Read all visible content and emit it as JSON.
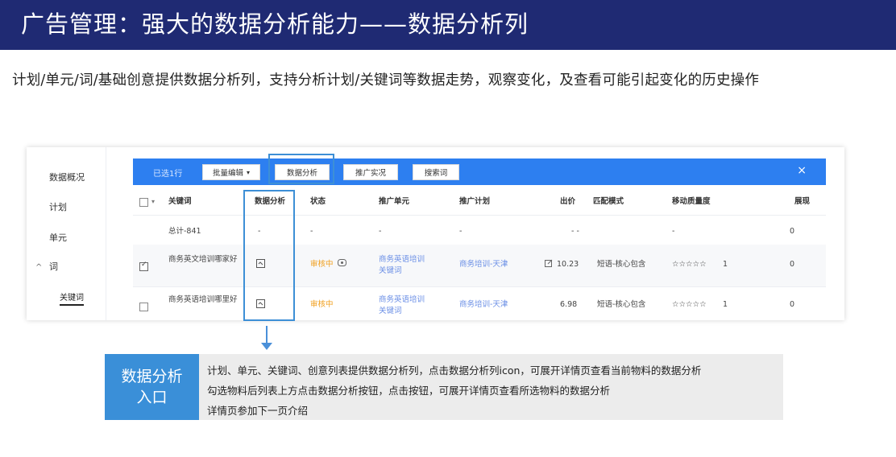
{
  "slide": {
    "title": "广告管理：强大的数据分析能力——数据分析列",
    "description": "计划/单元/词/基础创意提供数据分析列，支持分析计划/关键词等数据走势，观察变化，及查看可能引起变化的历史操作"
  },
  "sidebar": {
    "items": [
      {
        "label": "数据概况"
      },
      {
        "label": "计划"
      },
      {
        "label": "单元"
      },
      {
        "label": "词"
      }
    ],
    "expand_icon": "chevron-up-icon",
    "sub_item": "关键词"
  },
  "toolbar": {
    "selected_label": "已选1行",
    "batch_edit": "批量编辑",
    "data_analysis": "数据分析",
    "promo_report": "推广实况",
    "search_term": "搜索词",
    "close": "×"
  },
  "table": {
    "headers": {
      "keyword": "关键词",
      "analysis": "数据分析",
      "status": "状态",
      "unit": "推广单元",
      "plan": "推广计划",
      "bid": "出价",
      "match": "匹配模式",
      "mobile_quality": "移动质量度",
      "impressions": "展现"
    },
    "total_row": {
      "label": "总计-841",
      "analysis": "-",
      "status": "-",
      "unit": "-",
      "plan": "-",
      "bid": "- -",
      "match": "",
      "mobile_quality": "-",
      "impressions": "0"
    },
    "rows": [
      {
        "keyword": "商务英文培训哪家好",
        "status": "审核中",
        "unit": "商务英语培训关键词",
        "plan": "商务培训-天津",
        "bid": "10.23",
        "match": "短语-核心包含",
        "stars": "☆☆☆☆☆",
        "quality": "1",
        "impressions": "0",
        "checked": true
      },
      {
        "keyword": "商务英语培训哪里好",
        "status": "审核中",
        "unit": "商务英语培训关键词",
        "plan": "商务培训-天津",
        "bid": "6.98",
        "match": "短语-核心包含",
        "stars": "☆☆☆☆☆",
        "quality": "1",
        "impressions": "0",
        "checked": false
      }
    ]
  },
  "callout": {
    "label_line1": "数据分析",
    "label_line2": "入口",
    "lines": [
      "计划、单元、关键词、创意列表提供数据分析列，点击数据分析列icon，可展开详情页查看当前物料的数据分析",
      "勾选物料后列表上方点击数据分析按钮，点击按钮，可展开详情页查看所选物料的数据分析",
      "详情页参加下一页介绍"
    ]
  },
  "colors": {
    "header_bg": "#1f2a73",
    "toolbar_blue": "#2d7ff0",
    "highlight_blue": "#3d8fd6",
    "callout_label_bg": "#3a8fd8",
    "callout_text_bg": "#ececec",
    "status_orange": "#f0a020"
  }
}
